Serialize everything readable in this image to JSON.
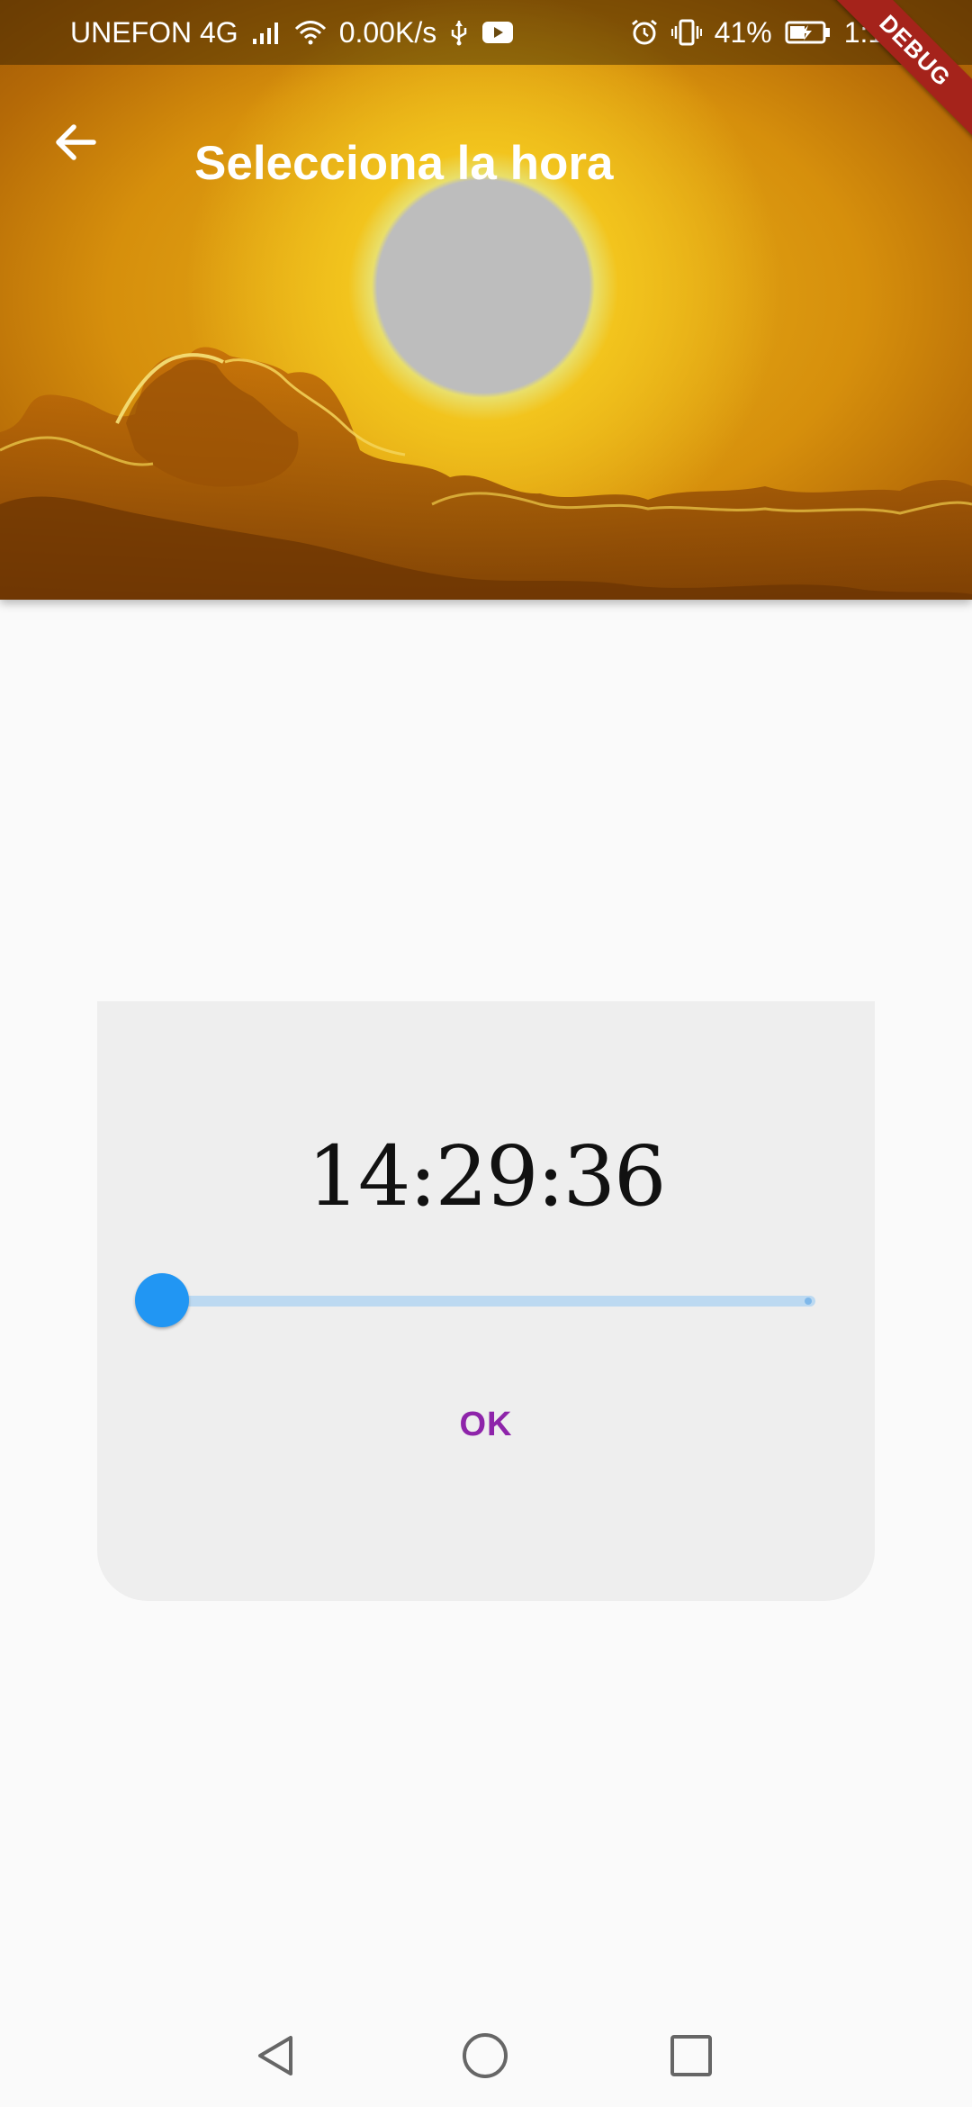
{
  "status_bar": {
    "carrier": "UNEFON 4G",
    "net_speed": "0.00K/s",
    "battery": "41%",
    "time": "1:16"
  },
  "debug_banner": "DEBUG",
  "app_bar": {
    "title": "Selecciona la hora",
    "back_icon": "arrow-back-icon"
  },
  "clock": {
    "time": "14:29:36"
  },
  "slider": {
    "value": 0,
    "accent_color": "#2196f3"
  },
  "actions": {
    "ok_label": "OK"
  },
  "nav": {
    "icons": [
      "back-triangle-icon",
      "home-circle-icon",
      "recents-square-icon"
    ]
  },
  "colors": {
    "button_text": "#8e24aa",
    "card": "#eeeeee",
    "debug_ribbon": "#a5231b"
  }
}
